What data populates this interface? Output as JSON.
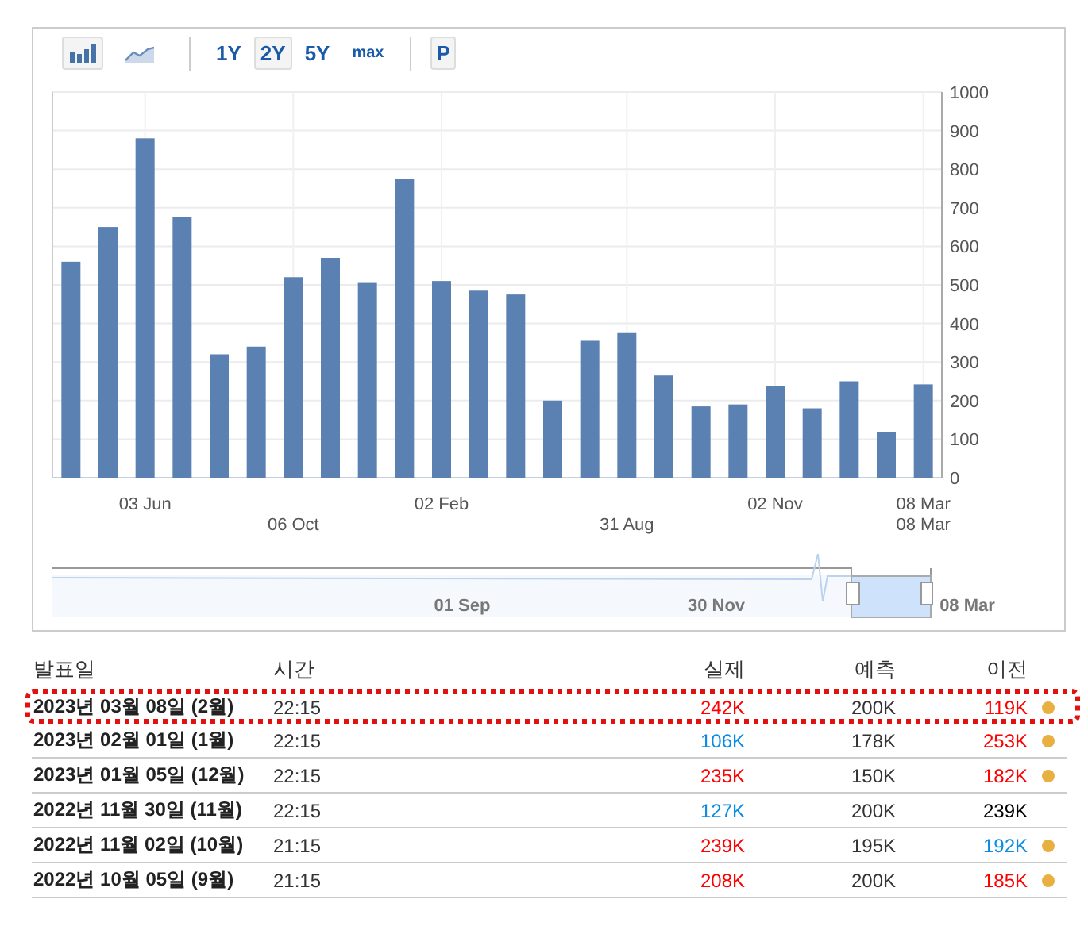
{
  "toolbar": {
    "chart_types": [
      {
        "kind": "bar",
        "selected": true
      },
      {
        "kind": "area",
        "selected": false
      }
    ],
    "ranges": [
      {
        "label": "1Y",
        "selected": false
      },
      {
        "label": "2Y",
        "selected": true
      },
      {
        "label": "5Y",
        "selected": false
      },
      {
        "label": "max",
        "selected": false
      }
    ],
    "print_button": "P"
  },
  "chart_data": {
    "type": "bar",
    "values": [
      560,
      650,
      880,
      675,
      320,
      340,
      520,
      570,
      505,
      775,
      510,
      485,
      475,
      200,
      355,
      375,
      265,
      185,
      190,
      238,
      180,
      250,
      118,
      242
    ],
    "ylim": [
      0,
      1000
    ],
    "yticks": [
      0,
      100,
      200,
      300,
      400,
      500,
      600,
      700,
      800,
      900,
      1000
    ],
    "grid": true
  },
  "date_labels": {
    "upper": [
      "03 Jun",
      "02 Feb",
      "02 Nov",
      "08 Mar"
    ],
    "lower": [
      "06 Oct",
      "31 Aug",
      "08 Mar"
    ]
  },
  "navigator": {
    "labels": [
      "01 Sep",
      "30 Nov",
      "08 Mar"
    ]
  },
  "table": {
    "columns": [
      "발표일",
      "시간",
      "실제",
      "예측",
      "이전"
    ],
    "rows": [
      {
        "date": "2023년 03월 08일 (2월)",
        "time": "22:15",
        "actual": {
          "text": "242K",
          "color": "#ff0000"
        },
        "forecast": "200K",
        "previous": {
          "text": "119K",
          "color": "#ff0000"
        },
        "dot": true,
        "highlighted": true
      },
      {
        "date": "2023년 02월 01일 (1월)",
        "time": "22:15",
        "actual": {
          "text": "106K",
          "color": "#0a8ce6"
        },
        "forecast": "178K",
        "previous": {
          "text": "253K",
          "color": "#ff0000"
        },
        "dot": true,
        "highlighted": false
      },
      {
        "date": "2023년 01월 05일 (12월)",
        "time": "22:15",
        "actual": {
          "text": "235K",
          "color": "#ff0000"
        },
        "forecast": "150K",
        "previous": {
          "text": "182K",
          "color": "#ff0000"
        },
        "dot": true,
        "highlighted": false
      },
      {
        "date": "2022년 11월 30일 (11월)",
        "time": "22:15",
        "actual": {
          "text": "127K",
          "color": "#0a8ce6"
        },
        "forecast": "200K",
        "previous": {
          "text": "239K",
          "color": "#000000"
        },
        "dot": false,
        "highlighted": false
      },
      {
        "date": "2022년 11월 02일 (10월)",
        "time": "21:15",
        "actual": {
          "text": "239K",
          "color": "#ff0000"
        },
        "forecast": "195K",
        "previous": {
          "text": "192K",
          "color": "#0a8ce6"
        },
        "dot": true,
        "highlighted": false
      },
      {
        "date": "2022년 10월 05일 (9월)",
        "time": "21:15",
        "actual": {
          "text": "208K",
          "color": "#ff0000"
        },
        "forecast": "200K",
        "previous": {
          "text": "185K",
          "color": "#ff0000"
        },
        "dot": true,
        "highlighted": false
      }
    ]
  }
}
